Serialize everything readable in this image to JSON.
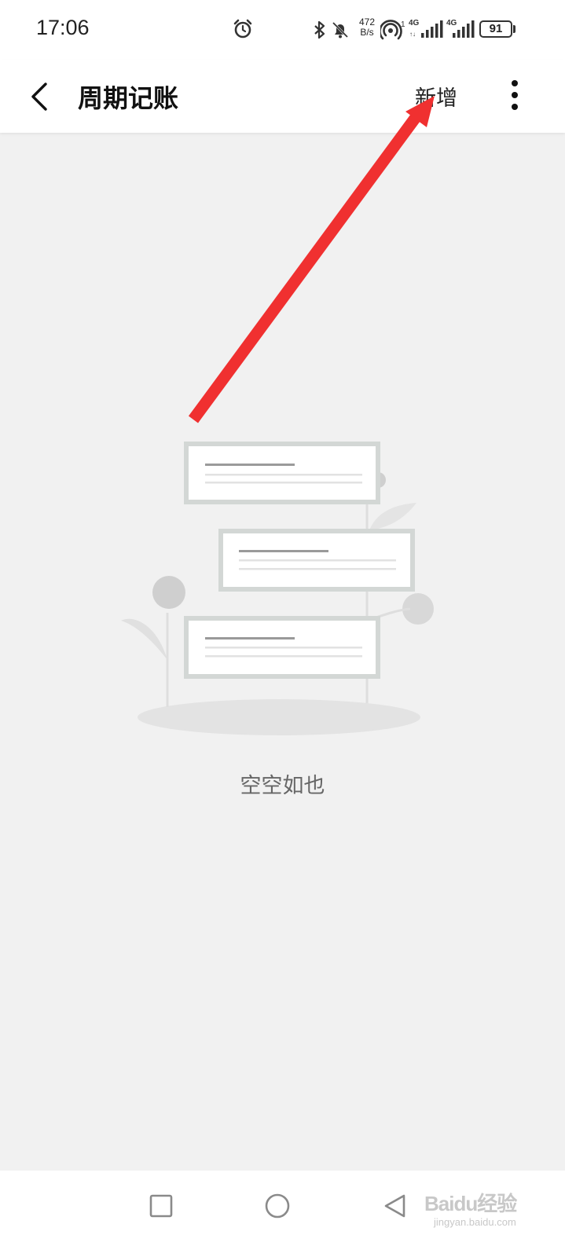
{
  "status_bar": {
    "time": "17:06",
    "net_speed_value": "472",
    "net_speed_unit": "B/s",
    "battery_level": "91",
    "icons": [
      "alarm-icon",
      "bluetooth-icon",
      "mute-bell-icon",
      "hotspot-icon",
      "signal-4g-icon",
      "signal-4g-icon",
      "battery-icon"
    ]
  },
  "app_bar": {
    "back_icon": "chevron-left-icon",
    "title": "周期记账",
    "add_label": "新增",
    "more_icon": "more-vertical-icon"
  },
  "empty_state": {
    "illustration": "empty-cards-illustration",
    "message": "空空如也"
  },
  "annotation": {
    "type": "arrow",
    "color": "#f03030",
    "points_to": "新增"
  },
  "nav_bar": {
    "icons": [
      "recent-apps-icon",
      "home-icon",
      "back-icon"
    ]
  },
  "watermark": {
    "text": "Baidu经验",
    "subtext": "jingyan.baidu.com"
  },
  "colors": {
    "background": "#f1f1f1",
    "surface": "#ffffff",
    "accent_arrow": "#f03030"
  }
}
